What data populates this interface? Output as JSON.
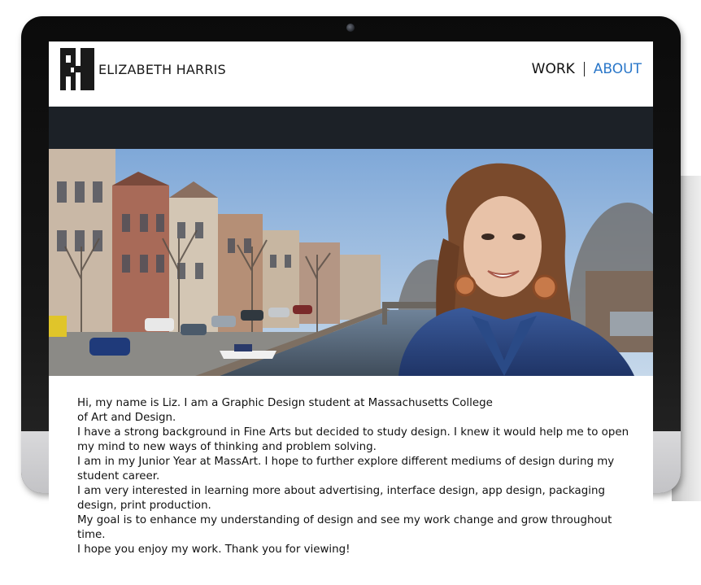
{
  "brand": {
    "logo_icon": "eh-monogram-icon",
    "name": "ELIZABETH HARRIS"
  },
  "nav": {
    "items": [
      {
        "label": "WORK",
        "active": false
      },
      {
        "label": "ABOUT",
        "active": true
      }
    ],
    "active_color": "#2a77c9"
  },
  "hero": {
    "image": "portrait-photo-canal"
  },
  "bio": {
    "paragraphs": [
      "Hi, my name is Liz. I am a Graphic Design student at Massachusetts College",
      "of Art and Design.",
      "I have a strong background in Fine Arts but decided to study design. I knew it would help me to open my mind to new ways of thinking and problem solving.",
      "I am in my Junior Year at MassArt. I hope to further explore different mediums of design during my student career.",
      "I am very interested in learning more about advertising, interface design, app design, packaging design, print production.",
      "My goal is to enhance my understanding of design and see my work change and grow throughout time.",
      "I hope you enjoy my work. Thank you for viewing!"
    ]
  },
  "colors": {
    "header_band": "#1c2127",
    "text": "#111111"
  }
}
